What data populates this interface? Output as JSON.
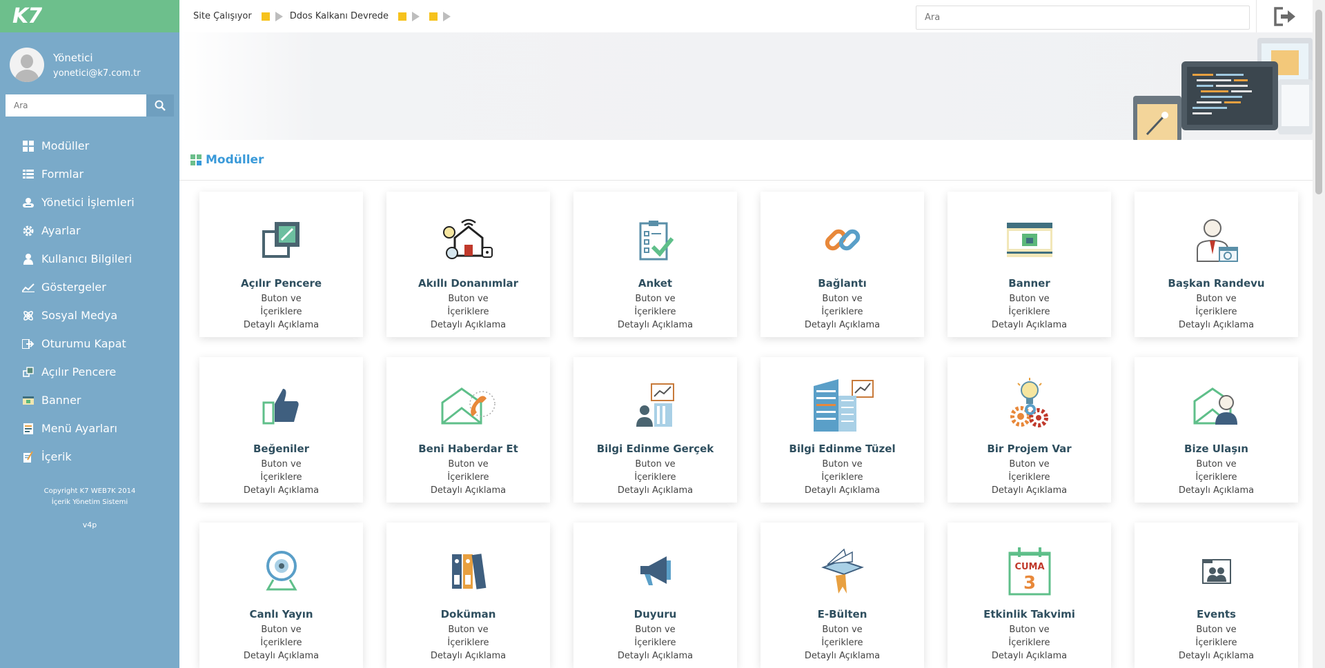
{
  "app": {
    "logo": "K7",
    "user_name": "Yönetici",
    "user_email": "yonetici@k7.com.tr",
    "sidebar_search_placeholder": "Ara",
    "copyright_line1": "Copyright K7 WEB7K 2014",
    "copyright_line2": "İçerik Yönetim Sistemi",
    "version": "v4p"
  },
  "sidebar": {
    "items": [
      {
        "label": "Modüller",
        "icon": "grid-icon"
      },
      {
        "label": "Formlar",
        "icon": "list-icon"
      },
      {
        "label": "Yönetici İşlemleri",
        "icon": "admin-icon"
      },
      {
        "label": "Ayarlar",
        "icon": "gear-icon"
      },
      {
        "label": "Kullanıcı Bilgileri",
        "icon": "user-icon"
      },
      {
        "label": "Göstergeler",
        "icon": "chart-icon"
      },
      {
        "label": "Sosyal Medya",
        "icon": "social-icon"
      },
      {
        "label": "Oturumu Kapat",
        "icon": "logout-icon"
      },
      {
        "label": "Açılır Pencere",
        "icon": "popup-icon"
      },
      {
        "label": "Banner",
        "icon": "banner-icon"
      },
      {
        "label": "Menü Ayarları",
        "icon": "menu-icon"
      },
      {
        "label": "İçerik",
        "icon": "content-icon"
      }
    ]
  },
  "topbar": {
    "status_site": "Site Çalışıyor",
    "status_ddos": "Ddos Kalkanı Devrede",
    "search_placeholder": "Ara",
    "status_color": "#f6c21c"
  },
  "main": {
    "section_title": "Modüller",
    "cards": [
      {
        "title": "Açılır Pencere",
        "desc": "Buton ve İçeriklere Detaylı Açıklama",
        "icon": "popup-window-icon"
      },
      {
        "title": "Akıllı Donanımlar",
        "desc": "Buton ve İçeriklere Detaylı Açıklama",
        "icon": "smart-home-icon"
      },
      {
        "title": "Anket",
        "desc": "Buton ve İçeriklere Detaylı Açıklama",
        "icon": "survey-clipboard-icon"
      },
      {
        "title": "Bağlantı",
        "desc": "Buton ve İçeriklere Detaylı Açıklama",
        "icon": "link-chain-icon"
      },
      {
        "title": "Banner",
        "desc": "Buton ve İçeriklere Detaylı Açıklama",
        "icon": "banner-image-icon"
      },
      {
        "title": "Başkan Randevu",
        "desc": "Buton ve İçeriklere Detaylı Açıklama",
        "icon": "president-appointment-icon"
      },
      {
        "title": "Beğeniler",
        "desc": "Buton ve İçeriklere Detaylı Açıklama",
        "icon": "thumbs-up-icon"
      },
      {
        "title": "Beni Haberdar Et",
        "desc": "Buton ve İçeriklere Detaylı Açıklama",
        "icon": "envelope-phone-icon"
      },
      {
        "title": "Bilgi Edinme Gerçek",
        "desc": "Buton ve İçeriklere Detaylı Açıklama",
        "icon": "person-building-chart-icon"
      },
      {
        "title": "Bilgi Edinme Tüzel",
        "desc": "Buton ve İçeriklere Detaylı Açıklama",
        "icon": "corporate-building-icon"
      },
      {
        "title": "Bir Projem Var",
        "desc": "Buton ve İçeriklere Detaylı Açıklama",
        "icon": "idea-gears-icon"
      },
      {
        "title": "Bize Ulaşın",
        "desc": "Buton ve İçeriklere Detaylı Açıklama",
        "icon": "contact-envelope-icon"
      },
      {
        "title": "Canlı Yayın",
        "desc": "Buton ve İçeriklere Detaylı Açıklama",
        "icon": "webcam-icon"
      },
      {
        "title": "Doküman",
        "desc": "Buton ve İçeriklere Detaylı Açıklama",
        "icon": "binders-icon"
      },
      {
        "title": "Duyuru",
        "desc": "Buton ve İçeriklere Detaylı Açıklama",
        "icon": "megaphone-icon"
      },
      {
        "title": "E-Bülten",
        "desc": "Buton ve İçeriklere Detaylı Açıklama",
        "icon": "newsletter-book-icon"
      },
      {
        "title": "Etkinlik Takvimi",
        "desc": "Buton ve İçeriklere Detaylı Açıklama",
        "icon": "calendar-icon",
        "cal_day": "CUMA",
        "cal_num": "3"
      },
      {
        "title": "Events",
        "desc": "Buton ve İçeriklere Detaylı Açıklama",
        "icon": "events-folder-icon"
      }
    ]
  }
}
